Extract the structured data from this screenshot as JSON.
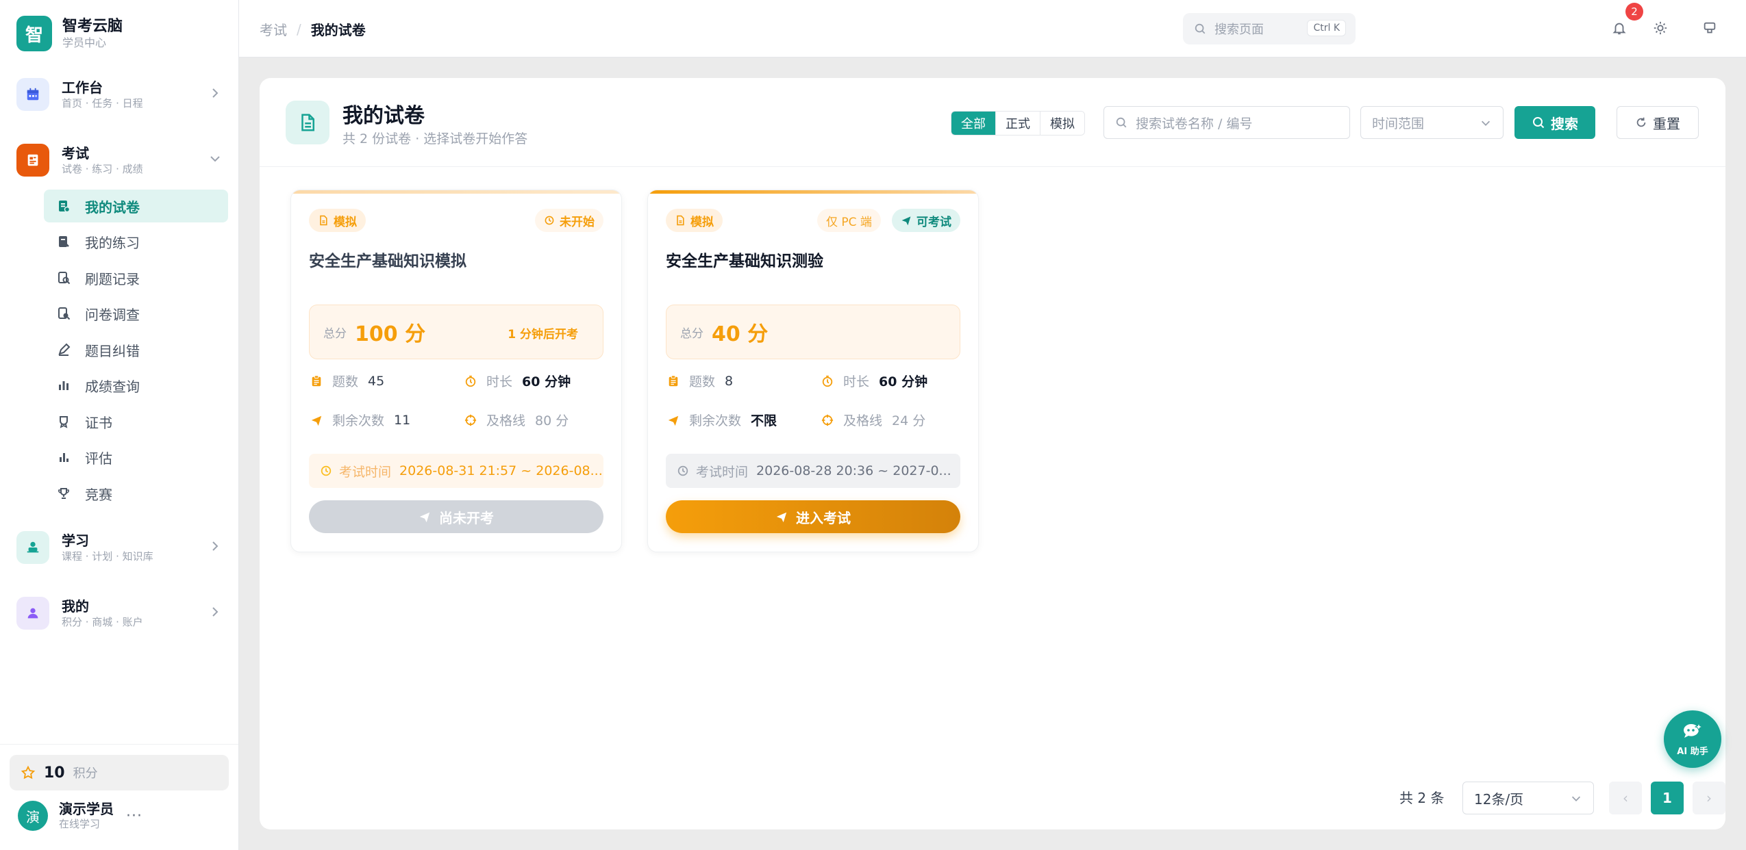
{
  "brand": {
    "logo": "智",
    "title": "智考云脑",
    "subtitle": "学员中心"
  },
  "nav": [
    {
      "title": "工作台",
      "subtitle": "首页 · 任务 · 日程",
      "icon": "calendar-icon"
    },
    {
      "title": "考试",
      "subtitle": "试卷 · 练习 · 成绩",
      "icon": "exam-icon"
    },
    {
      "title": "学习",
      "subtitle": "课程 · 计划 · 知识库",
      "icon": "study-icon"
    },
    {
      "title": "我的",
      "subtitle": "积分 · 商城 · 账户",
      "icon": "user-icon"
    }
  ],
  "exam_menu": [
    {
      "label": "我的试卷",
      "icon": "paper-icon"
    },
    {
      "label": "我的练习",
      "icon": "practice-icon"
    },
    {
      "label": "刷题记录",
      "icon": "record-icon"
    },
    {
      "label": "问卷调查",
      "icon": "survey-icon"
    },
    {
      "label": "题目纠错",
      "icon": "pen-icon"
    },
    {
      "label": "成绩查询",
      "icon": "bar-chart-icon"
    },
    {
      "label": "证书",
      "icon": "certificate-icon"
    },
    {
      "label": "评估",
      "icon": "assess-icon"
    },
    {
      "label": "竞赛",
      "icon": "trophy-icon"
    }
  ],
  "points": {
    "value": "10",
    "label": "积分"
  },
  "user": {
    "avatar": "演",
    "name": "演示学员",
    "status": "在线学习",
    "more": "···"
  },
  "header": {
    "crumb_parent": "考试",
    "crumb_sep": "/",
    "crumb_current": "我的试卷",
    "search_placeholder": "搜索页面",
    "shortcut": "Ctrl K",
    "notif_count": "2"
  },
  "page": {
    "title": "我的试卷",
    "subtitle": "共 2 份试卷 · 选择试卷开始作答",
    "filters": [
      "全部",
      "正式",
      "模拟"
    ],
    "search_placeholder": "搜索试卷名称 / 编号",
    "time_placeholder": "时间范围",
    "search_btn": "搜索",
    "reset_btn": "重置"
  },
  "cards": [
    {
      "type_tag": "模拟",
      "status_tag": "未开始",
      "title": "安全生产基础知识模拟",
      "score_label": "总分",
      "score": "100 分",
      "score_note": "1 分钟后开考",
      "questions_label": "题数",
      "questions": "45",
      "duration_label": "时长",
      "duration": "60 分钟",
      "attempts_label": "剩余次数",
      "attempts": "11",
      "pass_label": "及格线",
      "pass": "80 分",
      "time_label": "考试时间",
      "time": "2026-08-31 21:57 ~ 2026-08...",
      "cta": "尚未开考"
    },
    {
      "type_tag": "模拟",
      "pc_tag": "仅 PC 端",
      "status_tag": "可考试",
      "title": "安全生产基础知识测验",
      "score_label": "总分",
      "score": "40 分",
      "questions_label": "题数",
      "questions": "8",
      "duration_label": "时长",
      "duration": "60 分钟",
      "attempts_label": "剩余次数",
      "attempts": "不限",
      "pass_label": "及格线",
      "pass": "24 分",
      "time_label": "考试时间",
      "time": "2026-08-28 20:36 ~ 2027-0...",
      "cta": "进入考试"
    }
  ],
  "pagination": {
    "total": "共 2 条",
    "page_size": "12条/页",
    "current": "1",
    "prev": "‹",
    "next": "›"
  },
  "ai": {
    "label": "AI 助手"
  },
  "colors": {
    "primary": "#16a394",
    "orange": "#f59e0b",
    "danger": "#ef4444"
  }
}
